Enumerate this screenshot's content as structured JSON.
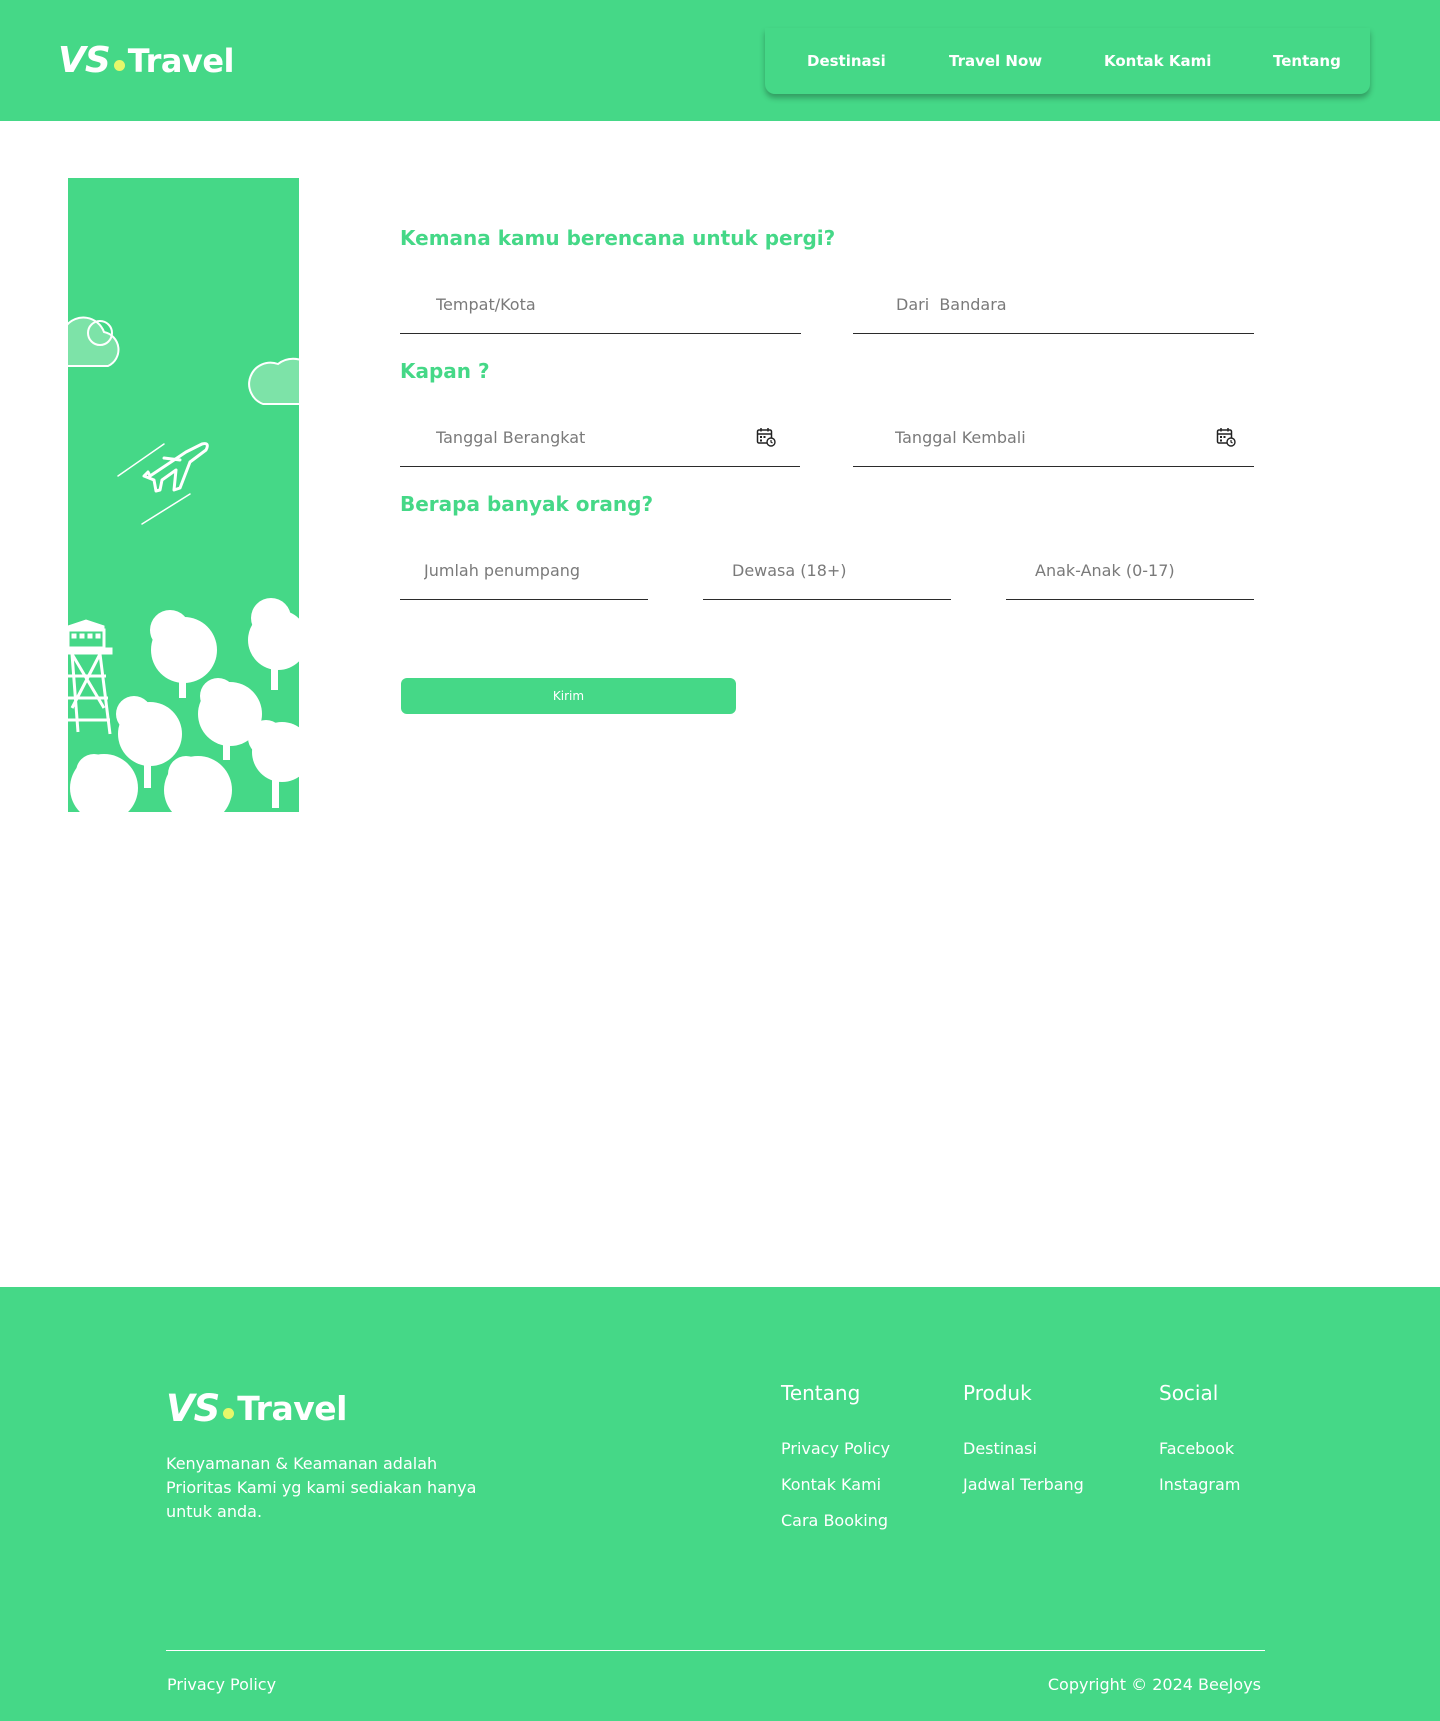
{
  "brand": {
    "vs": "VS",
    "name": "Travel",
    "dot_color": "#e7f76a"
  },
  "colors": {
    "primary": "#45d887",
    "text_dark": "#2b2b2b"
  },
  "nav": [
    {
      "label": "Destinasi"
    },
    {
      "label": "Travel Now"
    },
    {
      "label": "Kontak Kami"
    },
    {
      "label": "Tentang"
    }
  ],
  "form": {
    "q1": "Kemana kamu berencana untuk pergi?",
    "place_placeholder": "Tempat/Kota",
    "airport_placeholder": "Dari  Bandara",
    "q2": "Kapan ?",
    "depart_placeholder": "Tanggal Berangkat",
    "return_placeholder": "Tanggal Kembali",
    "calendar_icon": "calendar-icon",
    "q3": "Berapa banyak orang?",
    "passengers_placeholder": "Jumlah penumpang",
    "adults_placeholder": "Dewasa (18+)",
    "children_placeholder": "Anak-Anak (0-17)",
    "submit_label": "Kirim"
  },
  "footer": {
    "tagline": "Kenyamanan & Keamanan adalah Prioritas Kami yg kami sediakan hanya untuk anda.",
    "columns": [
      {
        "title": "Tentang",
        "links": [
          "Privacy Policy",
          "Kontak Kami",
          "Cara Booking"
        ]
      },
      {
        "title": "Produk",
        "links": [
          "Destinasi",
          "Jadwal Terbang"
        ]
      },
      {
        "title": "Social",
        "links": [
          "Facebook",
          "Instagram"
        ]
      }
    ],
    "bottom_link": "Privacy Policy",
    "copyright": "Copyright © 2024 BeeJoys"
  }
}
